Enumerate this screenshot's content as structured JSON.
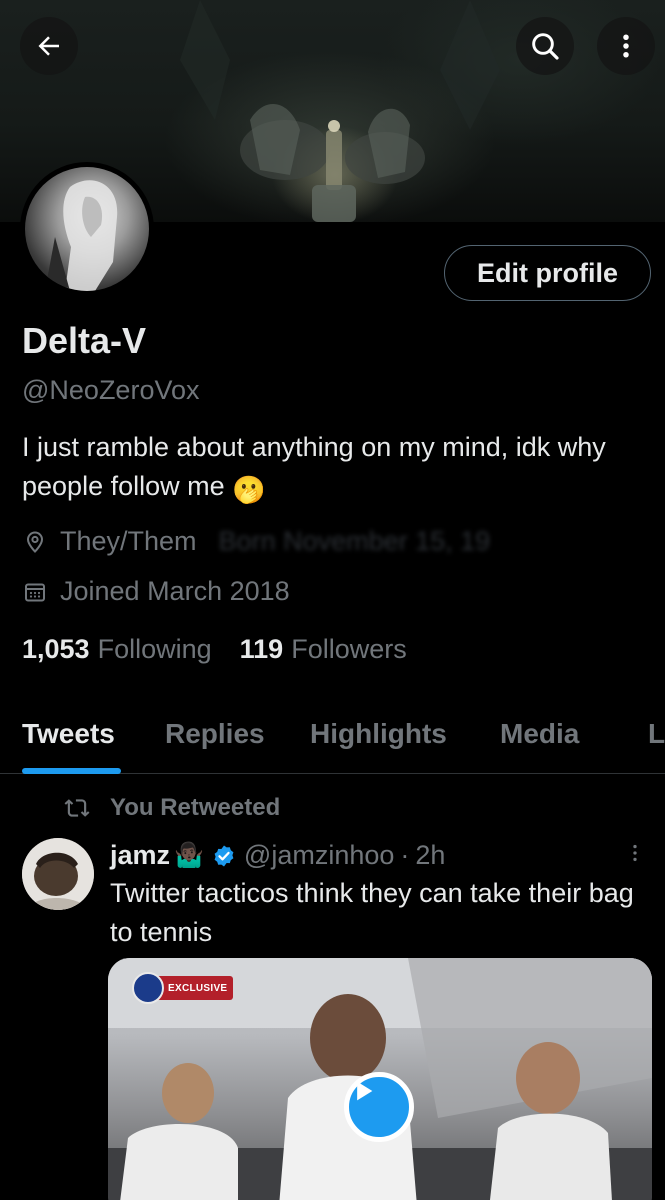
{
  "header": {
    "back_icon": "arrow-left-icon",
    "search_icon": "search-icon",
    "more_icon": "more-vertical-icon"
  },
  "profile": {
    "display_name": "Delta-V",
    "handle": "@NeoZeroVox",
    "bio": "I just ramble about anything on my mind, idk why people follow me",
    "bio_emoji": "🫢",
    "pronouns": "They/Them",
    "birthday_obscured": "Born November 15, 19",
    "joined": "Joined March 2018",
    "edit_button": "Edit profile"
  },
  "stats": {
    "following_count": "1,053",
    "following_label": "Following",
    "followers_count": "119",
    "followers_label": "Followers"
  },
  "tabs": [
    {
      "label": "Tweets",
      "active": true
    },
    {
      "label": "Replies",
      "active": false
    },
    {
      "label": "Highlights",
      "active": false
    },
    {
      "label": "Media",
      "active": false
    },
    {
      "label": "L",
      "active": false
    }
  ],
  "timeline": {
    "retweet_label": "You Retweeted",
    "tweet": {
      "author": "jamz",
      "author_emoji": "🤷🏿‍♂️",
      "handle": "@jamzinhoo",
      "separator": "·",
      "time": "2h",
      "text": "Twitter tacticos think they can take their bag to tennis",
      "media_badge": "EXCLUSIVE"
    }
  },
  "colors": {
    "background": "#000000",
    "accent": "#1d9bf0",
    "text_primary": "#e7e9ea",
    "text_secondary": "#71767b",
    "border": "#2f3336"
  }
}
